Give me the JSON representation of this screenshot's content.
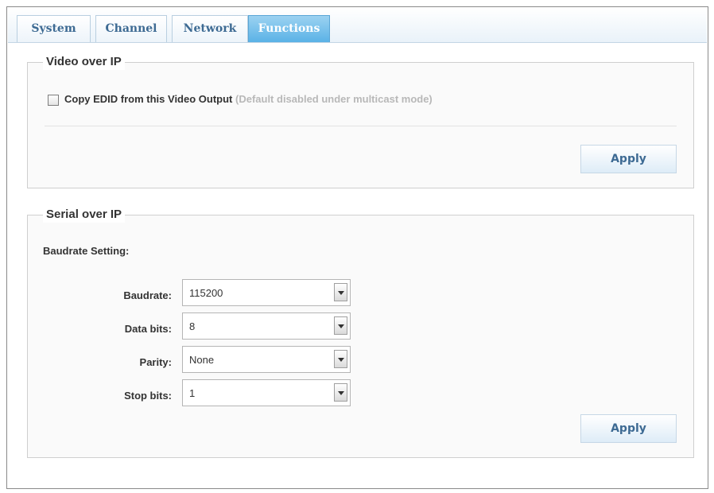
{
  "tabs": [
    {
      "label": "System",
      "active": false
    },
    {
      "label": "Channel",
      "active": false
    },
    {
      "label": "Network",
      "active": false
    },
    {
      "label": "Functions",
      "active": true
    }
  ],
  "video_over_ip": {
    "legend": "Video over IP",
    "copy_edid": {
      "label": "Copy EDID from this Video Output",
      "hint": "(Default disabled under multicast mode)",
      "checked": false
    },
    "apply_label": "Apply"
  },
  "serial_over_ip": {
    "legend": "Serial over IP",
    "section_label": "Baudrate Setting:",
    "fields": [
      {
        "label": "Baudrate:",
        "value": "115200"
      },
      {
        "label": "Data bits:",
        "value": "8"
      },
      {
        "label": "Parity:",
        "value": "None"
      },
      {
        "label": "Stop bits:",
        "value": "1"
      }
    ],
    "apply_label": "Apply"
  },
  "colors": {
    "tab_active": "#5ab2e6",
    "tab_text": "#3d6a93",
    "hint_text": "#b8b8b8"
  }
}
